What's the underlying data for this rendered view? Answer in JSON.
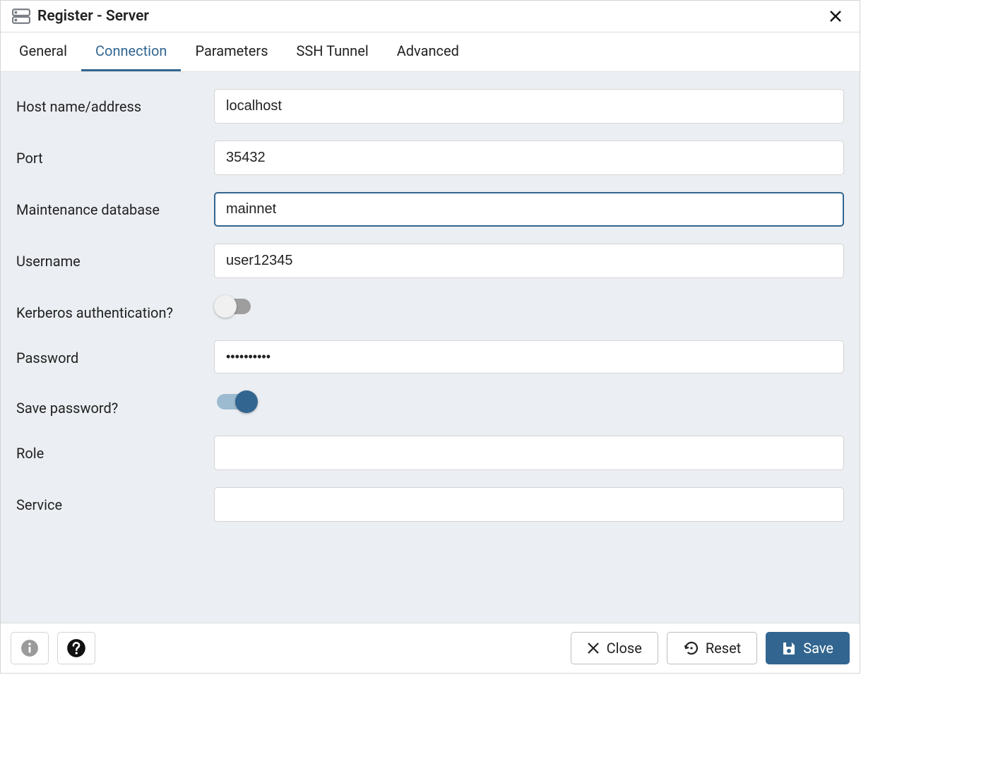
{
  "dialog": {
    "title": "Register - Server"
  },
  "tabs": {
    "general": "General",
    "connection": "Connection",
    "parameters": "Parameters",
    "ssh_tunnel": "SSH Tunnel",
    "advanced": "Advanced",
    "active": "connection"
  },
  "form": {
    "host": {
      "label": "Host name/address",
      "value": "localhost"
    },
    "port": {
      "label": "Port",
      "value": "35432"
    },
    "maintenance_db": {
      "label": "Maintenance database",
      "value": "mainnet",
      "focused": true
    },
    "username": {
      "label": "Username",
      "value": "user12345"
    },
    "kerberos": {
      "label": "Kerberos authentication?",
      "on": false
    },
    "password": {
      "label": "Password",
      "value": "••••••••••"
    },
    "save_password": {
      "label": "Save password?",
      "on": true
    },
    "role": {
      "label": "Role",
      "value": ""
    },
    "service": {
      "label": "Service",
      "value": ""
    }
  },
  "footer": {
    "close": "Close",
    "reset": "Reset",
    "save": "Save"
  }
}
